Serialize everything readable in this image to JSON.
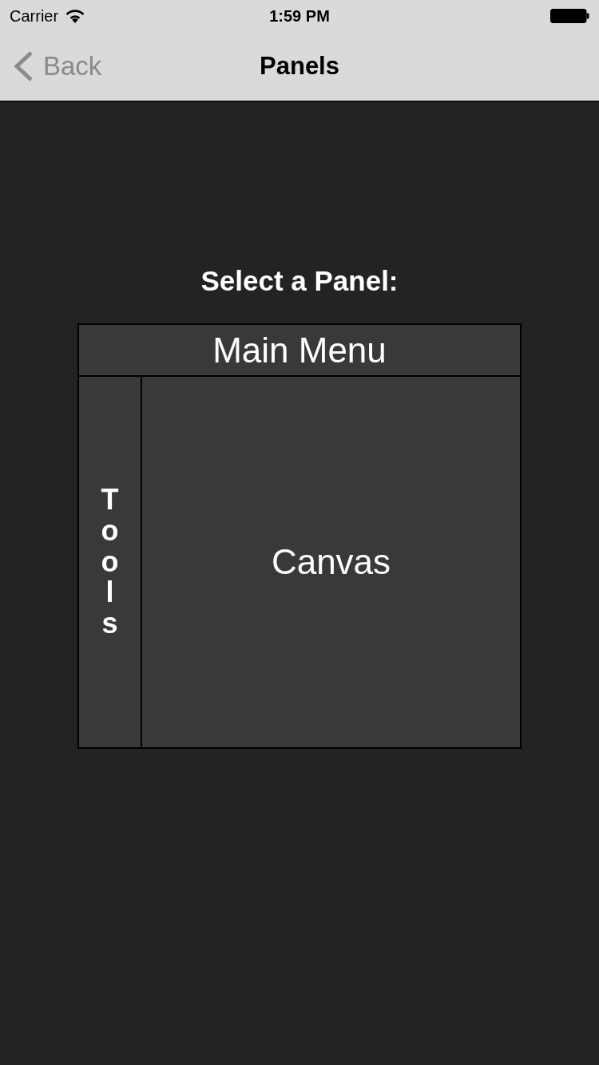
{
  "status_bar": {
    "carrier": "Carrier",
    "time": "1:59 PM"
  },
  "nav_bar": {
    "back": "Back",
    "title": "Panels"
  },
  "prompt": "Select a Panel:",
  "panels": [
    {
      "kind": "header",
      "label": "Main Menu"
    },
    {
      "kind": "sidebar",
      "label": "Tools"
    },
    {
      "kind": "canvas",
      "label": "Canvas"
    }
  ]
}
